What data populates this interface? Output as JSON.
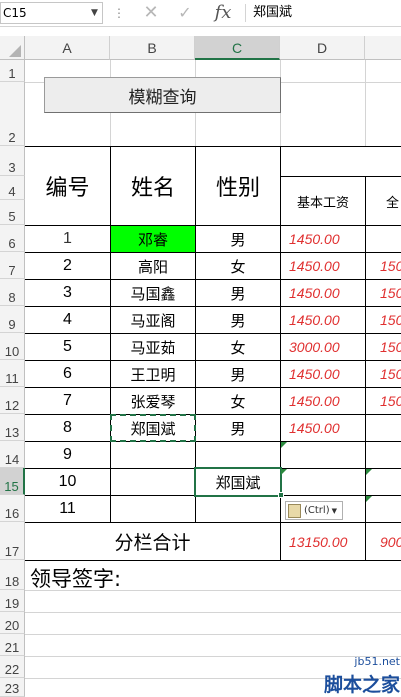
{
  "formula_bar": {
    "name_box": "C15",
    "cancel_icon": "✕",
    "enter_icon": "✓",
    "fx_label": "fx",
    "content": "郑国斌"
  },
  "columns": [
    "A",
    "B",
    "C",
    "D"
  ],
  "selected_column": "C",
  "rows": [
    "1",
    "2",
    "3",
    "4",
    "5",
    "6",
    "7",
    "8",
    "9",
    "10",
    "11",
    "12",
    "13",
    "14",
    "15",
    "16",
    "17",
    "18",
    "19",
    "20",
    "21",
    "22",
    "23"
  ],
  "selected_row": "15",
  "button_label": "模糊查询",
  "table": {
    "headers": {
      "id": "编号",
      "name": "姓名",
      "gender": "性别",
      "base_salary": "基本工资",
      "next_col_partial": "全"
    },
    "records": [
      {
        "id": "1",
        "name": "邓睿",
        "gender": "男",
        "base": "1450.00",
        "next": ""
      },
      {
        "id": "2",
        "name": "高阳",
        "gender": "女",
        "base": "1450.00",
        "next": "150"
      },
      {
        "id": "3",
        "name": "马国鑫",
        "gender": "男",
        "base": "1450.00",
        "next": "150"
      },
      {
        "id": "4",
        "name": "马亚阁",
        "gender": "男",
        "base": "1450.00",
        "next": "150"
      },
      {
        "id": "5",
        "name": "马亚茹",
        "gender": "女",
        "base": "3000.00",
        "next": "150"
      },
      {
        "id": "6",
        "name": "王卫明",
        "gender": "男",
        "base": "1450.00",
        "next": "150"
      },
      {
        "id": "7",
        "name": "张爱琴",
        "gender": "女",
        "base": "1450.00",
        "next": "150"
      },
      {
        "id": "8",
        "name": "郑国斌",
        "gender": "男",
        "base": "1450.00",
        "next": ""
      },
      {
        "id": "9",
        "name": "",
        "gender": "",
        "base": "",
        "next": ""
      },
      {
        "id": "10",
        "name": "",
        "gender": "郑国斌",
        "base": "",
        "next": ""
      },
      {
        "id": "11",
        "name": "",
        "gender": "",
        "base": "",
        "next": ""
      }
    ],
    "subtotal_label": "分栏合计",
    "subtotal_base": "13150.00",
    "subtotal_next": "900"
  },
  "signature_label": "领导签字:",
  "paste_options_label": "(Ctrl)",
  "watermark": {
    "url": "jb51.net",
    "brand": "脚本之家"
  },
  "colors": {
    "highlight_fill": "#00ff00",
    "salary_text": "#e03030",
    "selection_green": "#217346"
  }
}
